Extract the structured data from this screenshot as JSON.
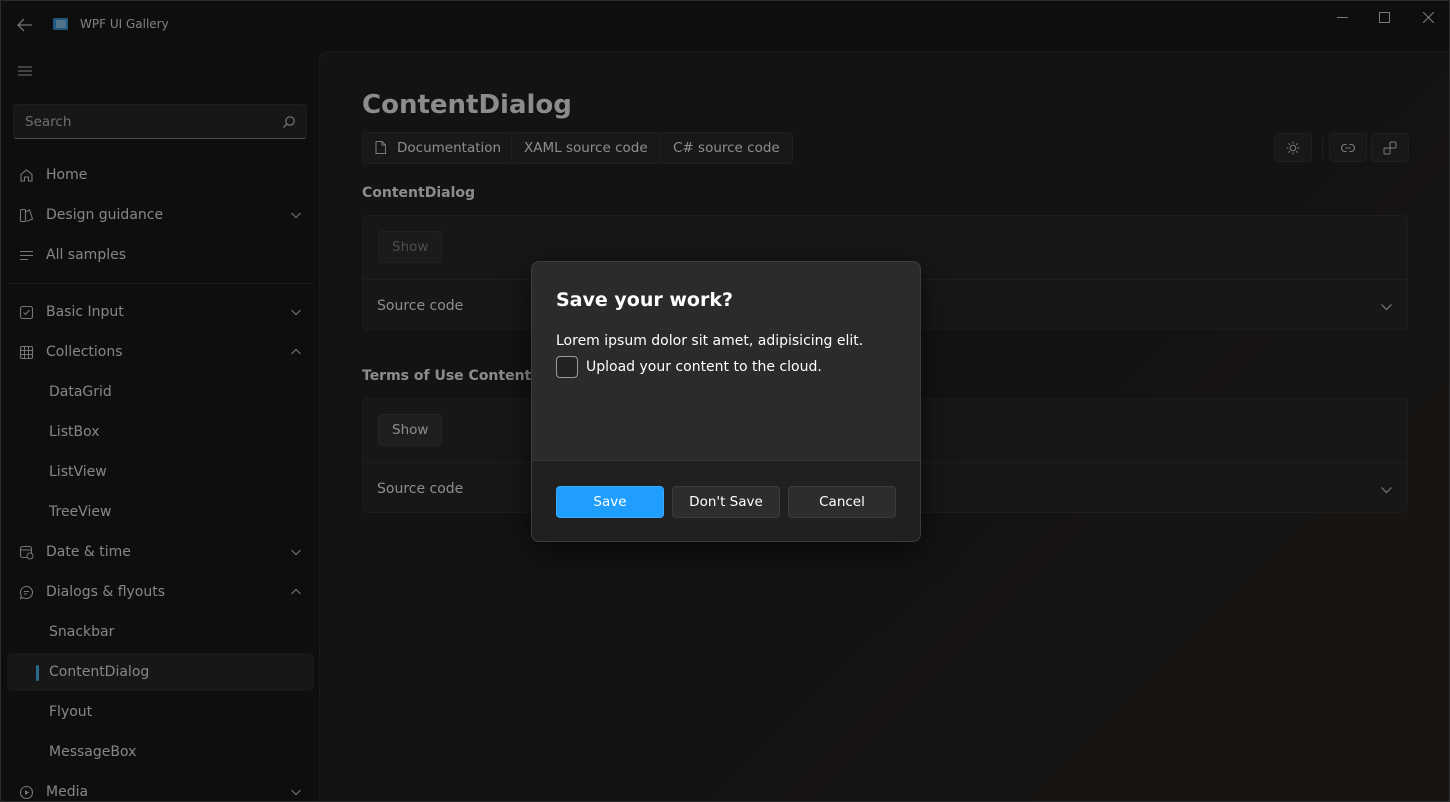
{
  "window": {
    "title": "WPF UI Gallery"
  },
  "search": {
    "placeholder": "Search"
  },
  "sidebar": {
    "items": [
      {
        "label": "Home"
      },
      {
        "label": "Design guidance"
      },
      {
        "label": "All samples"
      },
      {
        "label": "Basic Input"
      },
      {
        "label": "Collections"
      },
      {
        "label": "DataGrid"
      },
      {
        "label": "ListBox"
      },
      {
        "label": "ListView"
      },
      {
        "label": "TreeView"
      },
      {
        "label": "Date & time"
      },
      {
        "label": "Dialogs & flyouts"
      },
      {
        "label": "Snackbar"
      },
      {
        "label": "ContentDialog"
      },
      {
        "label": "Flyout"
      },
      {
        "label": "MessageBox"
      },
      {
        "label": "Media"
      }
    ]
  },
  "page": {
    "title": "ContentDialog",
    "links": [
      "Documentation",
      "XAML source code",
      "C# source code"
    ]
  },
  "sections": [
    {
      "title": "ContentDialog",
      "show_label": "Show",
      "source_label": "Source code"
    },
    {
      "title": "Terms of Use ContentDialog",
      "show_label": "Show",
      "source_label": "Source code"
    }
  ],
  "dialog": {
    "title": "Save your work?",
    "body": "Lorem ipsum dolor sit amet, adipisicing elit.",
    "checkbox_label": "Upload your content to the cloud.",
    "buttons": {
      "primary": "Save",
      "secondary": "Don't Save",
      "close": "Cancel"
    }
  },
  "colors": {
    "accent": "#1f9eff",
    "selection_indicator": "#4cc2ff",
    "background": "#1a1b1d"
  }
}
